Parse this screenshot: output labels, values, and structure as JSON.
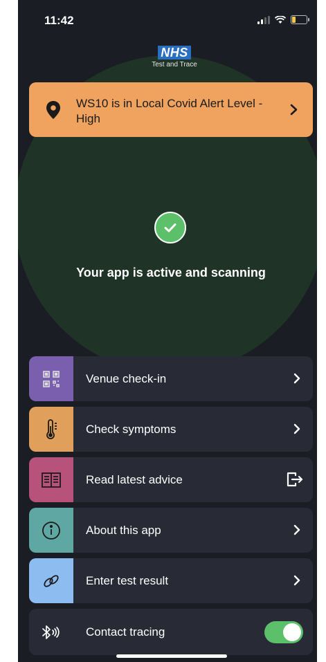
{
  "status_bar": {
    "time": "11:42"
  },
  "logo": {
    "brand": "NHS",
    "subtitle": "Test and Trace"
  },
  "alert": {
    "text": "WS10 is in Local Covid Alert Level - High",
    "color": "#f0a35e"
  },
  "status": {
    "message": "Your app is active and scanning"
  },
  "menu": [
    {
      "label": "Venue check-in",
      "icon": "qr-code-icon",
      "icon_bg": "#7a5fae"
    },
    {
      "label": "Check symptoms",
      "icon": "thermometer-icon",
      "icon_bg": "#e0a05c"
    },
    {
      "label": "Read latest advice",
      "icon": "book-icon",
      "icon_bg": "#b7537a"
    },
    {
      "label": "About this app",
      "icon": "info-icon",
      "icon_bg": "#5fa7a3"
    },
    {
      "label": "Enter test result",
      "icon": "link-icon",
      "icon_bg": "#8cbcf0"
    },
    {
      "label": "Contact tracing",
      "icon": "bluetooth-icon",
      "toggle_on": true
    }
  ],
  "colors": {
    "background": "#1b1d24",
    "card": "#282b36",
    "accent_green": "#5cc06a"
  }
}
